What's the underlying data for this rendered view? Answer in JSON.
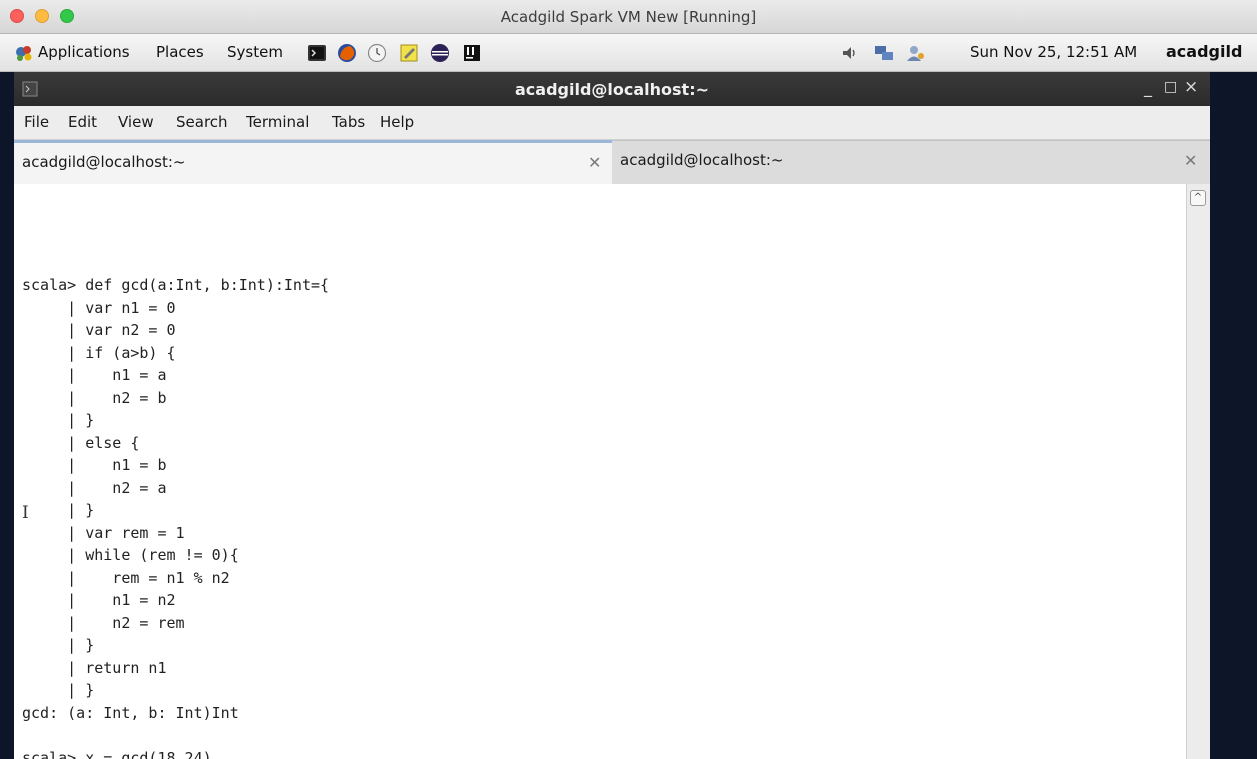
{
  "vm_window": {
    "title": "Acadgild Spark VM New [Running]"
  },
  "panel": {
    "menus": [
      "Applications",
      "Places",
      "System"
    ],
    "launcher_icons": [
      "terminal-icon",
      "firefox-icon",
      "clock-icon",
      "text-editor-icon",
      "eclipse-icon",
      "intellij-icon"
    ],
    "tray_icons": [
      "volume-icon",
      "network-icon",
      "user-switch-icon"
    ],
    "clock": "Sun Nov 25, 12:51 AM",
    "username": "acadgild"
  },
  "terminal": {
    "title": "acadgild@localhost:~",
    "controls": {
      "minimize": "_",
      "maximize": "□",
      "close": "×"
    },
    "menu": [
      "File",
      "Edit",
      "View",
      "Search",
      "Terminal",
      "Tabs",
      "Help"
    ],
    "tabs": [
      {
        "label": "acadgild@localhost:~",
        "active": true
      },
      {
        "label": "acadgild@localhost:~",
        "active": false
      }
    ],
    "tab_close_glyph": "✕",
    "scroll_up_glyph": "^",
    "cursor_glyph": "I",
    "lines": [
      "scala> def gcd(a:Int, b:Int):Int={",
      "     | var n1 = 0",
      "     | var n2 = 0",
      "     | if (a>b) {",
      "     |    n1 = a",
      "     |    n2 = b",
      "     | }",
      "     | else {",
      "     |    n1 = b",
      "     |    n2 = a",
      "     | }",
      "     | var rem = 1",
      "     | while (rem != 0){",
      "     |    rem = n1 % n2",
      "     |    n1 = n2",
      "     |    n2 = rem",
      "     | }",
      "     | return n1",
      "     | }",
      "gcd: (a: Int, b: Int)Int",
      "",
      "scala> x = gcd(18,24)"
    ]
  },
  "colors": {
    "terminal_titlebar": "#2f2f2f",
    "active_tab_accent": "#9ab6d8",
    "desktop_background": "#0c1628"
  }
}
